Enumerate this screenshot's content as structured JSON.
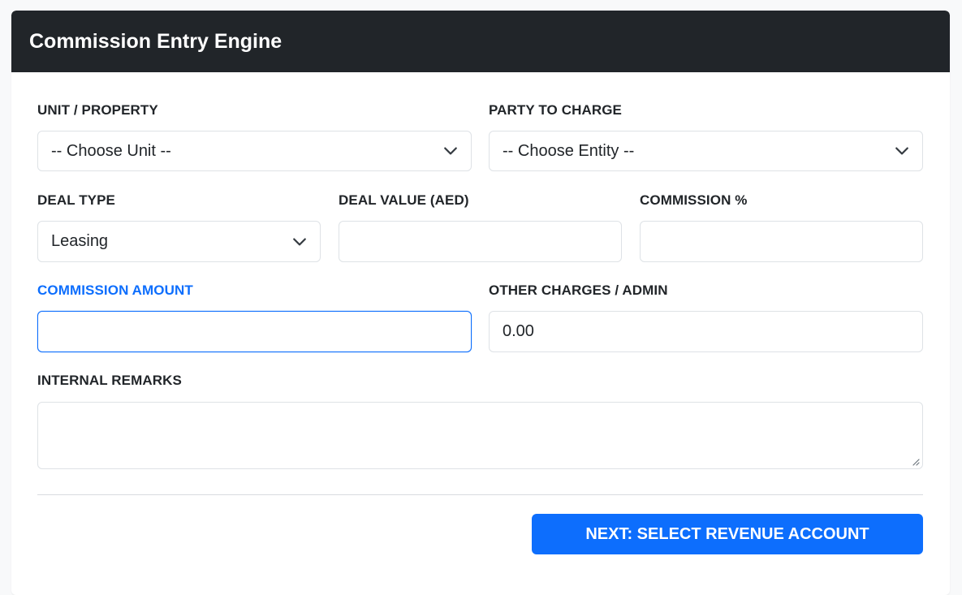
{
  "header": {
    "title": "Commission Entry Engine"
  },
  "form": {
    "unit": {
      "label": "UNIT / PROPERTY",
      "value": "-- Choose Unit --"
    },
    "party": {
      "label": "PARTY TO CHARGE",
      "value": "-- Choose Entity --"
    },
    "deal_type": {
      "label": "DEAL TYPE",
      "value": "Leasing"
    },
    "deal_value": {
      "label": "DEAL VALUE (AED)",
      "value": ""
    },
    "commission_pct": {
      "label": "COMMISSION %",
      "value": ""
    },
    "commission_amount": {
      "label": "COMMISSION AMOUNT",
      "value": ""
    },
    "other_charges": {
      "label": "OTHER CHARGES / ADMIN",
      "value": "0.00"
    },
    "remarks": {
      "label": "INTERNAL REMARKS",
      "value": ""
    }
  },
  "actions": {
    "next_label": "NEXT: SELECT REVENUE ACCOUNT"
  },
  "colors": {
    "header_bg": "#212529",
    "accent": "#0d6efd",
    "page_bg": "#f8f9fa"
  },
  "icons": {
    "select_arrow": "chevron-down-icon",
    "resize": "resize-grip-icon"
  }
}
